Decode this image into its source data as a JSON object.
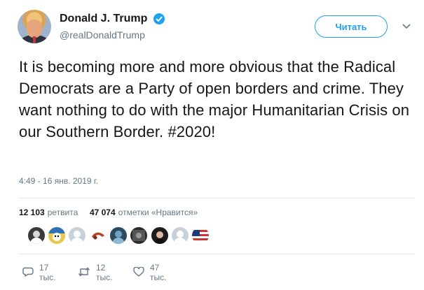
{
  "user": {
    "display_name": "Donald J. Trump",
    "handle": "@realDonaldTrump",
    "verified": true
  },
  "follow_button": {
    "label": "Читать"
  },
  "tweet": {
    "text": "It is becoming more and more obvious that the Radical Democrats are a Party of open borders and crime. They want nothing to do with the major Humanitarian Crisis on our Southern Border. #2020!",
    "timestamp": "4:49 - 16 янв. 2019 г."
  },
  "stats": {
    "retweets_count": "12 103",
    "retweets_label": "ретвита",
    "likes_count": "47 074",
    "likes_label": "отметки «Нравится»"
  },
  "likers": [
    {
      "icon": "liker-avatar-1"
    },
    {
      "icon": "liker-avatar-2"
    },
    {
      "icon": "liker-avatar-3"
    },
    {
      "icon": "liker-avatar-4"
    },
    {
      "icon": "liker-avatar-5"
    },
    {
      "icon": "liker-avatar-6"
    },
    {
      "icon": "liker-avatar-7"
    },
    {
      "icon": "liker-avatar-8"
    },
    {
      "icon": "liker-avatar-9"
    }
  ],
  "actions": {
    "reply_count": "17 тыс.",
    "retweet_count": "12 тыс.",
    "like_count": "47 тыс."
  },
  "colors": {
    "accent": "#1da1f2",
    "text": "#14171a",
    "secondary": "#657786",
    "divider": "#e6ecf0"
  }
}
